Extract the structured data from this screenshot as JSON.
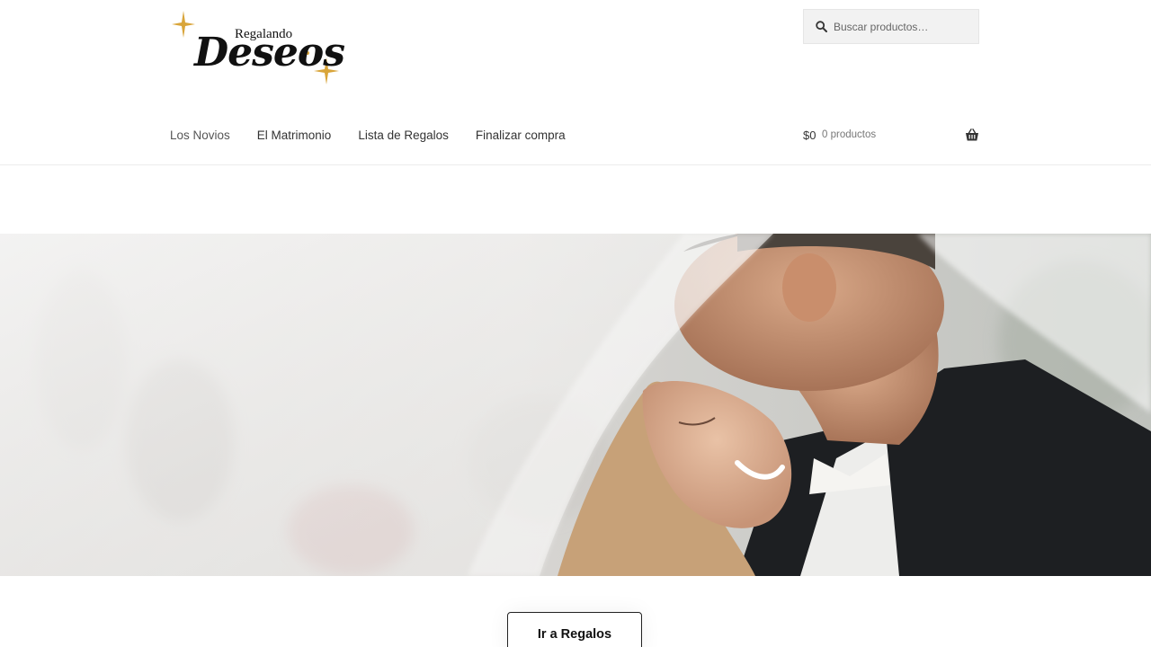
{
  "brand": {
    "logo_small": "Regalando",
    "logo_big": "Deseos",
    "accent_color": "#d9a53a"
  },
  "search": {
    "placeholder": "Buscar productos…",
    "icon": "search-icon"
  },
  "nav": {
    "items": [
      {
        "label": "Los Novios"
      },
      {
        "label": "El Matrimonio"
      },
      {
        "label": "Lista de Regalos"
      },
      {
        "label": "Finalizar compra"
      }
    ]
  },
  "cart": {
    "amount": "$0",
    "count": "0 productos",
    "icon": "basket-icon"
  },
  "hero": {
    "image": "wedding-couple-under-veil"
  },
  "cta": {
    "label": "Ir a Regalos"
  }
}
